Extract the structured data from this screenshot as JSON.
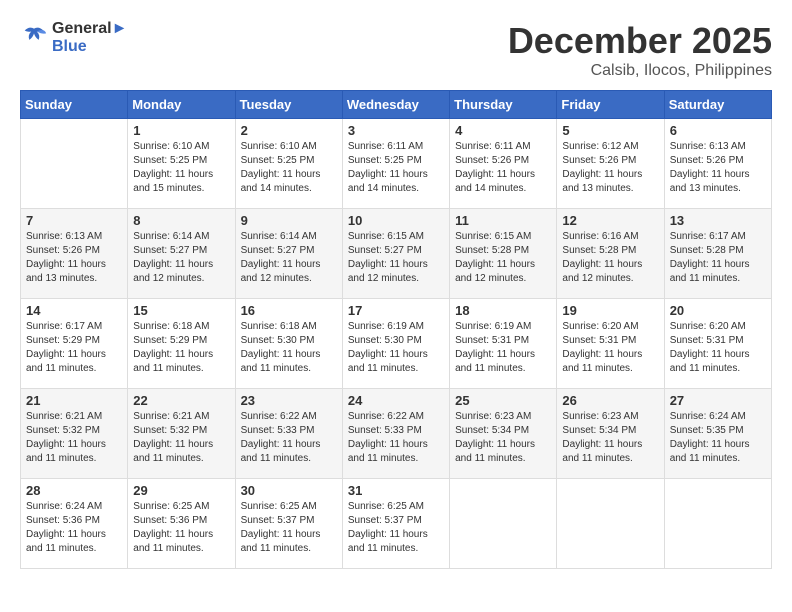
{
  "logo": {
    "line1": "General",
    "line2": "Blue"
  },
  "title": "December 2025",
  "location": "Calsib, Ilocos, Philippines",
  "days_of_week": [
    "Sunday",
    "Monday",
    "Tuesday",
    "Wednesday",
    "Thursday",
    "Friday",
    "Saturday"
  ],
  "weeks": [
    [
      {
        "day": "",
        "info": ""
      },
      {
        "day": "1",
        "info": "Sunrise: 6:10 AM\nSunset: 5:25 PM\nDaylight: 11 hours\nand 15 minutes."
      },
      {
        "day": "2",
        "info": "Sunrise: 6:10 AM\nSunset: 5:25 PM\nDaylight: 11 hours\nand 14 minutes."
      },
      {
        "day": "3",
        "info": "Sunrise: 6:11 AM\nSunset: 5:25 PM\nDaylight: 11 hours\nand 14 minutes."
      },
      {
        "day": "4",
        "info": "Sunrise: 6:11 AM\nSunset: 5:26 PM\nDaylight: 11 hours\nand 14 minutes."
      },
      {
        "day": "5",
        "info": "Sunrise: 6:12 AM\nSunset: 5:26 PM\nDaylight: 11 hours\nand 13 minutes."
      },
      {
        "day": "6",
        "info": "Sunrise: 6:13 AM\nSunset: 5:26 PM\nDaylight: 11 hours\nand 13 minutes."
      }
    ],
    [
      {
        "day": "7",
        "info": "Sunrise: 6:13 AM\nSunset: 5:26 PM\nDaylight: 11 hours\nand 13 minutes."
      },
      {
        "day": "8",
        "info": "Sunrise: 6:14 AM\nSunset: 5:27 PM\nDaylight: 11 hours\nand 12 minutes."
      },
      {
        "day": "9",
        "info": "Sunrise: 6:14 AM\nSunset: 5:27 PM\nDaylight: 11 hours\nand 12 minutes."
      },
      {
        "day": "10",
        "info": "Sunrise: 6:15 AM\nSunset: 5:27 PM\nDaylight: 11 hours\nand 12 minutes."
      },
      {
        "day": "11",
        "info": "Sunrise: 6:15 AM\nSunset: 5:28 PM\nDaylight: 11 hours\nand 12 minutes."
      },
      {
        "day": "12",
        "info": "Sunrise: 6:16 AM\nSunset: 5:28 PM\nDaylight: 11 hours\nand 12 minutes."
      },
      {
        "day": "13",
        "info": "Sunrise: 6:17 AM\nSunset: 5:28 PM\nDaylight: 11 hours\nand 11 minutes."
      }
    ],
    [
      {
        "day": "14",
        "info": "Sunrise: 6:17 AM\nSunset: 5:29 PM\nDaylight: 11 hours\nand 11 minutes."
      },
      {
        "day": "15",
        "info": "Sunrise: 6:18 AM\nSunset: 5:29 PM\nDaylight: 11 hours\nand 11 minutes."
      },
      {
        "day": "16",
        "info": "Sunrise: 6:18 AM\nSunset: 5:30 PM\nDaylight: 11 hours\nand 11 minutes."
      },
      {
        "day": "17",
        "info": "Sunrise: 6:19 AM\nSunset: 5:30 PM\nDaylight: 11 hours\nand 11 minutes."
      },
      {
        "day": "18",
        "info": "Sunrise: 6:19 AM\nSunset: 5:31 PM\nDaylight: 11 hours\nand 11 minutes."
      },
      {
        "day": "19",
        "info": "Sunrise: 6:20 AM\nSunset: 5:31 PM\nDaylight: 11 hours\nand 11 minutes."
      },
      {
        "day": "20",
        "info": "Sunrise: 6:20 AM\nSunset: 5:31 PM\nDaylight: 11 hours\nand 11 minutes."
      }
    ],
    [
      {
        "day": "21",
        "info": "Sunrise: 6:21 AM\nSunset: 5:32 PM\nDaylight: 11 hours\nand 11 minutes."
      },
      {
        "day": "22",
        "info": "Sunrise: 6:21 AM\nSunset: 5:32 PM\nDaylight: 11 hours\nand 11 minutes."
      },
      {
        "day": "23",
        "info": "Sunrise: 6:22 AM\nSunset: 5:33 PM\nDaylight: 11 hours\nand 11 minutes."
      },
      {
        "day": "24",
        "info": "Sunrise: 6:22 AM\nSunset: 5:33 PM\nDaylight: 11 hours\nand 11 minutes."
      },
      {
        "day": "25",
        "info": "Sunrise: 6:23 AM\nSunset: 5:34 PM\nDaylight: 11 hours\nand 11 minutes."
      },
      {
        "day": "26",
        "info": "Sunrise: 6:23 AM\nSunset: 5:34 PM\nDaylight: 11 hours\nand 11 minutes."
      },
      {
        "day": "27",
        "info": "Sunrise: 6:24 AM\nSunset: 5:35 PM\nDaylight: 11 hours\nand 11 minutes."
      }
    ],
    [
      {
        "day": "28",
        "info": "Sunrise: 6:24 AM\nSunset: 5:36 PM\nDaylight: 11 hours\nand 11 minutes."
      },
      {
        "day": "29",
        "info": "Sunrise: 6:25 AM\nSunset: 5:36 PM\nDaylight: 11 hours\nand 11 minutes."
      },
      {
        "day": "30",
        "info": "Sunrise: 6:25 AM\nSunset: 5:37 PM\nDaylight: 11 hours\nand 11 minutes."
      },
      {
        "day": "31",
        "info": "Sunrise: 6:25 AM\nSunset: 5:37 PM\nDaylight: 11 hours\nand 11 minutes."
      },
      {
        "day": "",
        "info": ""
      },
      {
        "day": "",
        "info": ""
      },
      {
        "day": "",
        "info": ""
      }
    ]
  ]
}
